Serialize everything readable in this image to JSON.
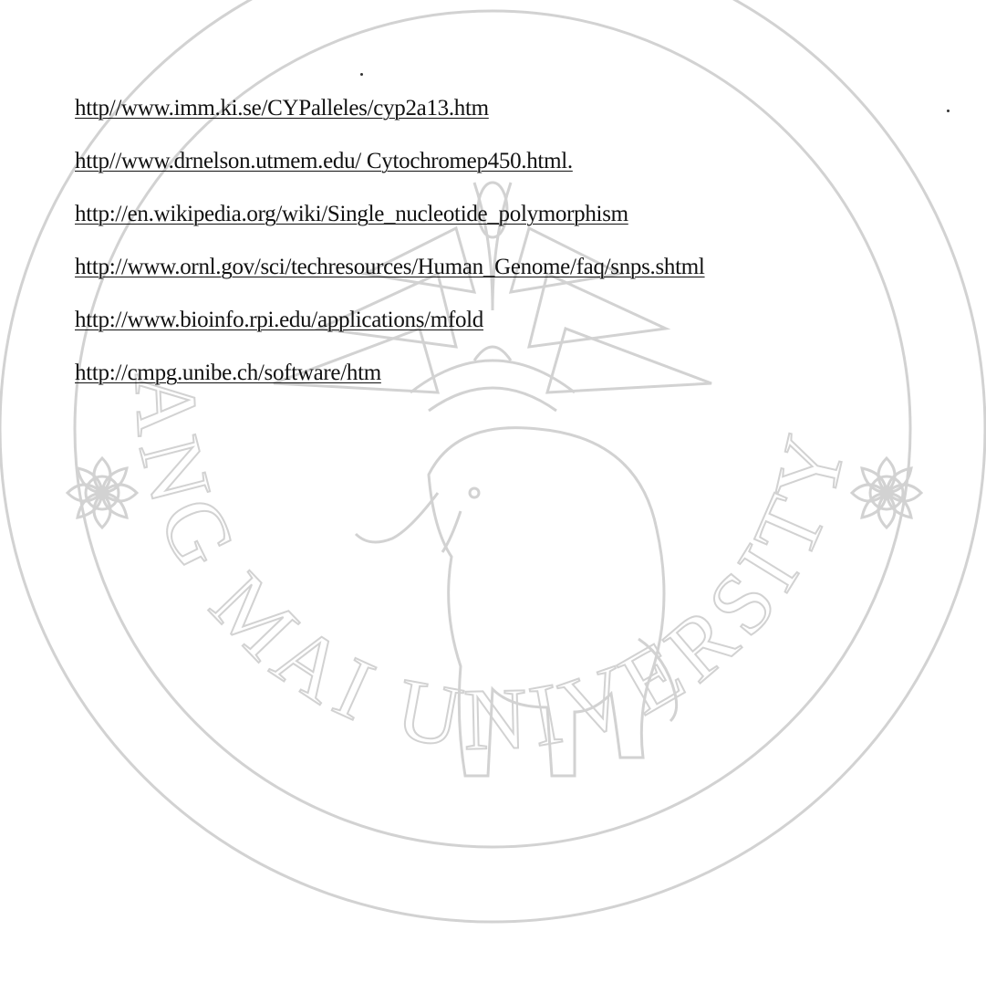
{
  "document": {
    "references": [
      "http//www.imm.ki.se/CYPalleles/cyp2a13.htm",
      "http//www.drnelson.utmem.edu/ Cytochromep450.html.",
      "http://en.wikipedia.org/wiki/Single_nucleotide_polymorphism",
      "http://www.ornl.gov/sci/techresources/Human_Genome/faq/snps.shtml",
      "http://www.bioinfo.rpi.edu/applications/mfold",
      "http://cmpg.unibe.ch/software/htm"
    ]
  },
  "watermark": {
    "icon": "chiang-mai-university-seal",
    "arc_text": "CHIANG MAI UNIVERSITY 1964",
    "color": "#d4d4d4"
  }
}
